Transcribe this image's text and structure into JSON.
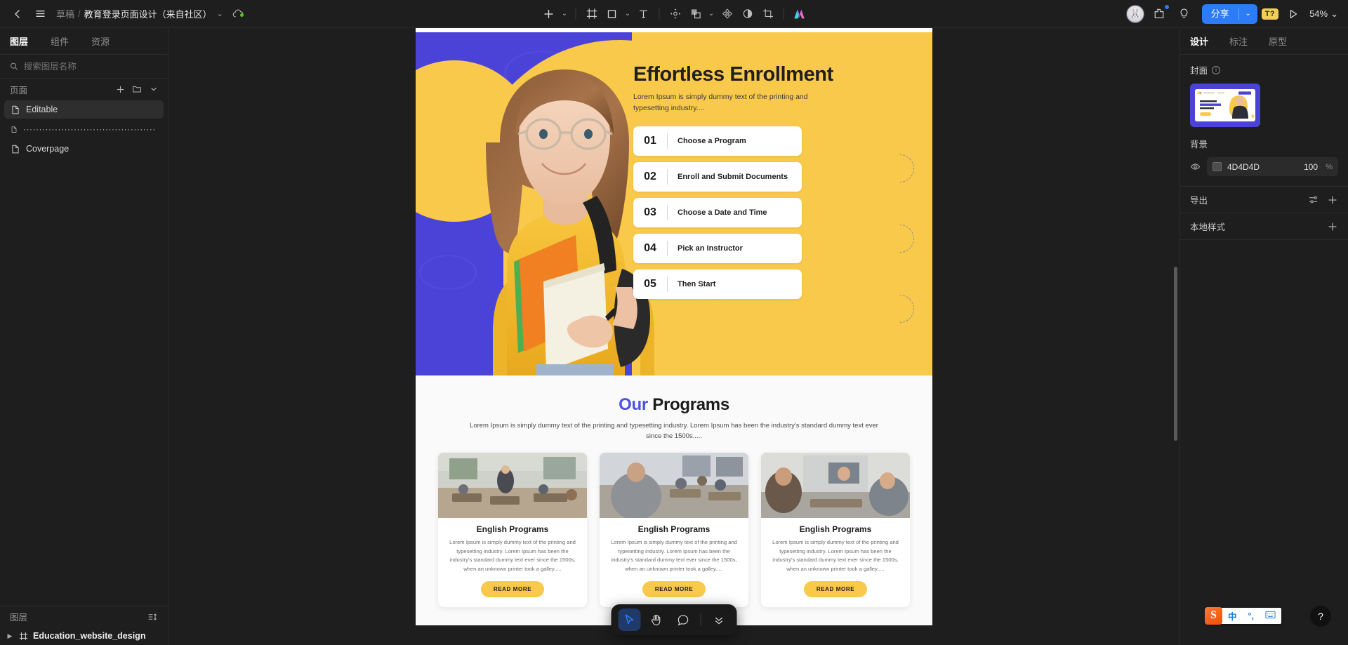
{
  "topbar": {
    "back_icon": "chevron-left-icon",
    "menu_icon": "hamburger-menu-icon",
    "breadcrumb": {
      "project": "草稿",
      "separator": "/",
      "file": "教育登录页面设计（来自社区）"
    },
    "tools": [
      {
        "name": "add-plus-tool",
        "glyph": "+"
      },
      {
        "name": "frame-tool",
        "glyph": "frame"
      },
      {
        "name": "rectangle-tool",
        "glyph": "square"
      },
      {
        "name": "text-tool",
        "glyph": "T"
      },
      {
        "name": "move-transform-tool",
        "glyph": "move"
      },
      {
        "name": "boolean-group-tool",
        "glyph": "layers"
      },
      {
        "name": "component-tool",
        "glyph": "component"
      },
      {
        "name": "mask-tool",
        "glyph": "half-circle"
      },
      {
        "name": "crop-tool",
        "glyph": "crop"
      },
      {
        "name": "ai-assistant-tool",
        "glyph": "ai"
      }
    ],
    "share_label": "分享",
    "share_caret": "⌄",
    "text_badge": "T?",
    "zoom_level": "54%",
    "zoom_caret": "⌄"
  },
  "left_panel": {
    "tabs": [
      {
        "label": "图层",
        "active": true
      },
      {
        "label": "组件",
        "active": false
      },
      {
        "label": "资源",
        "active": false
      }
    ],
    "search_placeholder": "搜索图层名称",
    "pages_section_title": "页面",
    "pages": [
      {
        "label": "Editable",
        "selected": true
      },
      {
        "label": "·······························································",
        "selected": false
      },
      {
        "label": "Coverpage",
        "selected": false
      }
    ],
    "layers_section_title": "图层",
    "layers": [
      {
        "label": "Education_website_design"
      }
    ]
  },
  "right_panel": {
    "tabs": [
      {
        "label": "设计",
        "active": true
      },
      {
        "label": "标注",
        "active": false
      },
      {
        "label": "原型",
        "active": false
      }
    ],
    "cover_label": "封面",
    "background_label": "背景",
    "background_hex": "4D4D4D",
    "background_opacity": "100",
    "opacity_unit": "%",
    "export_label": "导出",
    "local_styles_label": "本地样式"
  },
  "canvas": {
    "hero": {
      "title": "Effortless Enrollment",
      "subtitle": "Lorem Ipsum is simply dummy text of the printing and typesetting industry....",
      "steps": [
        {
          "num": "01",
          "label": "Choose a Program"
        },
        {
          "num": "02",
          "label": "Enroll and Submit Documents"
        },
        {
          "num": "03",
          "label": "Choose a Date and Time"
        },
        {
          "num": "04",
          "label": "Pick an Instructor"
        },
        {
          "num": "05",
          "label": "Then Start"
        }
      ]
    },
    "programs": {
      "title_accent": "Our",
      "title_rest": " Programs",
      "subtitle": "Lorem Ipsum is simply dummy text of the printing and typesetting industry. Lorem Ipsum has been the industry's standard dummy text ever since the 1500s.....",
      "cards": [
        {
          "title": "English Programs",
          "text": "Lorem Ipsum is simply dummy text of the printing and typesetting industry. Lorem Ipsum has been the industry's standard dummy text ever since the 1500s, when an unknown printer took a galley.....",
          "button": "READ MORE"
        },
        {
          "title": "English Programs",
          "text": "Lorem Ipsum is simply dummy text of the printing and typesetting industry. Lorem Ipsum has been the industry's standard dummy text ever since the 1500s, when an unknown printer took a galley.....",
          "button": "READ MORE"
        },
        {
          "title": "English Programs",
          "text": "Lorem Ipsum is simply dummy text of the printing and typesetting industry. Lorem Ipsum has been the industry's standard dummy text ever since the 1500s, when an unknown printer took a galley.....",
          "button": "READ MORE"
        }
      ]
    }
  },
  "float_toolbar": {
    "items": [
      {
        "name": "cursor-select-tool",
        "active": true
      },
      {
        "name": "hand-pan-tool",
        "active": false
      },
      {
        "name": "comment-tool",
        "active": false
      },
      {
        "name": "chevron-double-down-icon",
        "active": false
      }
    ]
  },
  "ime": {
    "logo": "S",
    "mode": "中",
    "punctuation": "°,",
    "keyboard_icon": "keyboard-icon"
  },
  "help": {
    "label": "?"
  },
  "colors": {
    "accent_blue": "#2b7cf6",
    "hero_yellow": "#f9c94b",
    "hero_purple": "#4b43d8",
    "brand_indigo": "#4b52e8",
    "panel_bg": "#1e1e1e"
  }
}
